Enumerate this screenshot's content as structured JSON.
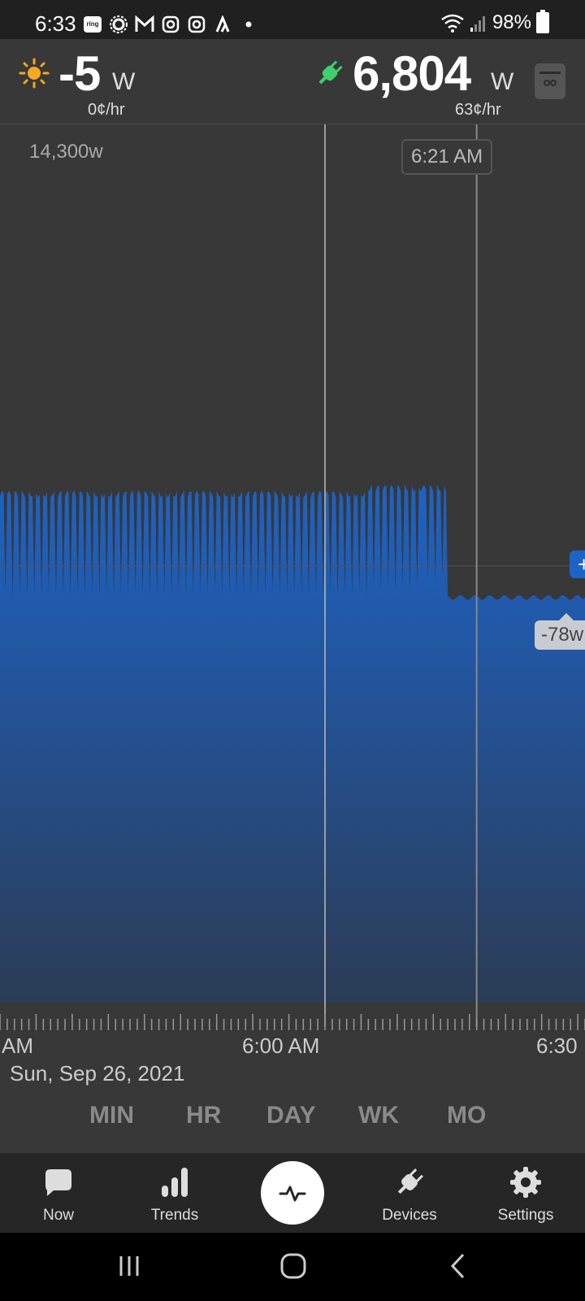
{
  "status_bar": {
    "time": "6:33",
    "notification_icons": [
      "ring-icon",
      "sun-gear-icon",
      "mail-icon",
      "instagram-icon",
      "instagram-icon",
      "strava-icon",
      "dot-icon"
    ],
    "ring_text": "ring",
    "battery": "98%"
  },
  "header": {
    "solar": {
      "value": "-5",
      "unit": "W",
      "rate": "0¢/hr",
      "icon": "sun-icon",
      "color": "#f5a623"
    },
    "usage": {
      "value": "6,804",
      "unit": "W",
      "rate": "63¢/hr",
      "icon": "plug-icon",
      "color": "#3ecf6e"
    },
    "meter_icon": "meter-icon"
  },
  "chart": {
    "max_label": "14,300w",
    "cursor_time": "6:21 AM",
    "cursor_value": "-78w",
    "plus_label": "+",
    "x_labels": [
      "AM",
      "6:00 AM",
      "6:30"
    ],
    "date": "Sun, Sep 26, 2021",
    "fill_color": "#1e63c6"
  },
  "chart_data": {
    "type": "area",
    "ylim": [
      0,
      14300
    ],
    "x_range_minutes": [
      -45,
      36
    ],
    "cursor_minute": 21,
    "series": [
      {
        "values_description_segments": [
          {
            "from": -45,
            "to": 6,
            "baseline": 6900,
            "spike_top": 8600
          },
          {
            "from": 6,
            "to": 13.5,
            "baseline": 7000,
            "spike_top": 8700
          },
          {
            "from": 13.5,
            "to": 17,
            "baseline": 7150,
            "spike_top": 8700
          },
          {
            "from": 17,
            "to": 36,
            "baseline": 6850,
            "spike_top": 6850
          }
        ]
      }
    ]
  },
  "range_tabs": [
    "MIN",
    "HR",
    "DAY",
    "WK",
    "MO"
  ],
  "nav": [
    {
      "label": "Now",
      "icon": "chat-bubble-icon"
    },
    {
      "label": "Trends",
      "icon": "bar-chart-icon"
    },
    {
      "label": "",
      "icon": "pulse-icon"
    },
    {
      "label": "Devices",
      "icon": "plug-icon"
    },
    {
      "label": "Settings",
      "icon": "gear-icon"
    }
  ]
}
